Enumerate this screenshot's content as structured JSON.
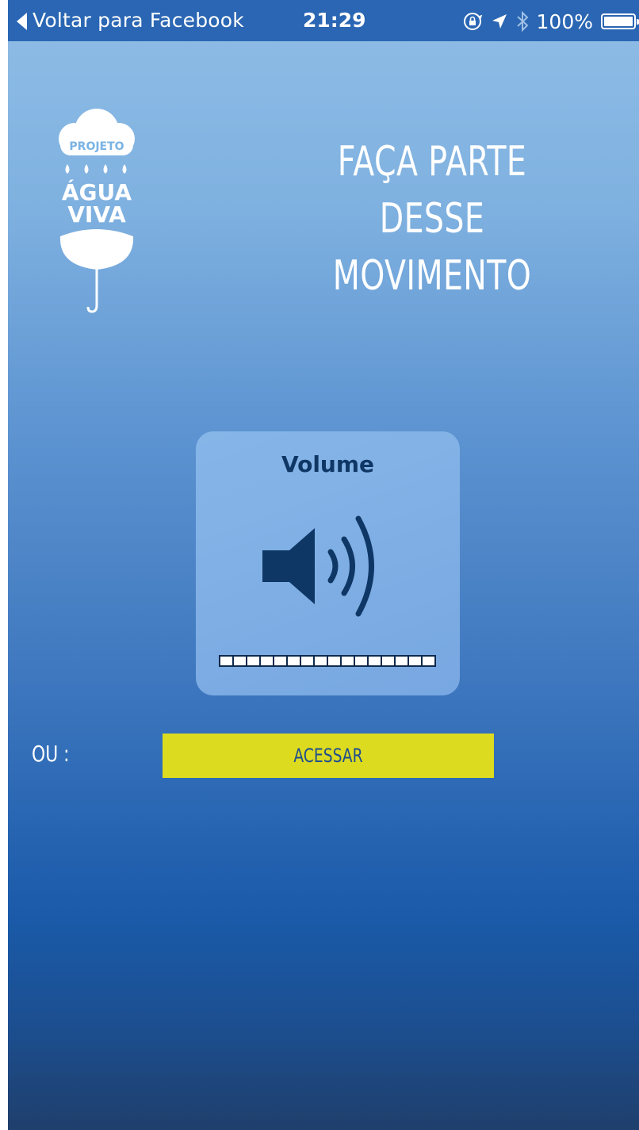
{
  "status_bar": {
    "back_label": "Voltar para Facebook",
    "time": "21:29",
    "battery_percent": "100%",
    "battery_level": 1.0,
    "icons": [
      "back-chevron-icon",
      "orientation-lock-icon",
      "location-arrow-icon",
      "bluetooth-icon",
      "battery-icon"
    ]
  },
  "logo": {
    "line1": "PROJETO",
    "line2": "ÁGUA",
    "line3": "VIVA"
  },
  "headline": {
    "line1": "FAÇA PARTE DESSE",
    "line2": "MOVIMENTO"
  },
  "volume_hud": {
    "title": "Volume",
    "icon": "speaker-volume-icon",
    "level_segments": 16,
    "level_filled": 16
  },
  "access_row": {
    "or_label": "OU :",
    "button_label": "ACESSAR"
  },
  "colors": {
    "status_bar": "#2a66b3",
    "button_bg": "#dddb1f",
    "button_text": "#1f4e8c",
    "hud_text": "#0f3766"
  }
}
